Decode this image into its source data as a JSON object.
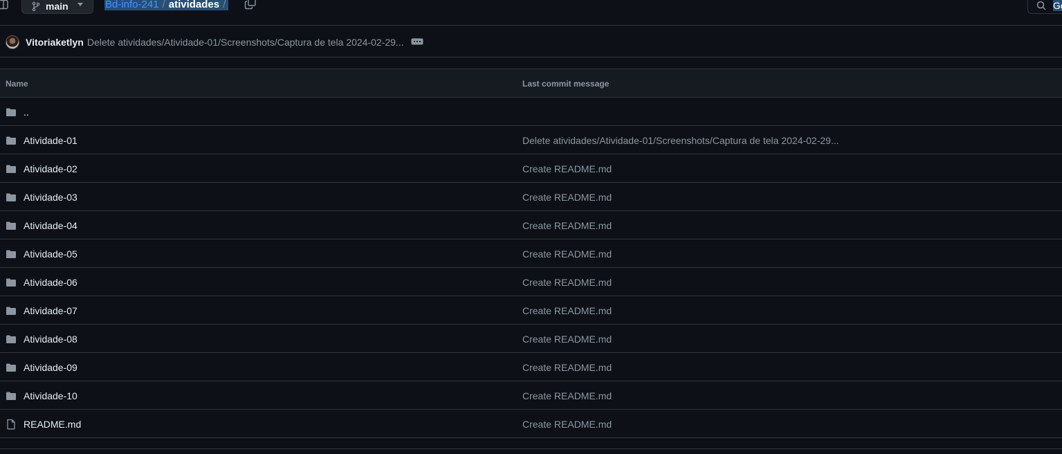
{
  "topbar": {
    "branch": "main",
    "breadcrumb": {
      "repo": "Bd-info-241",
      "separator": "/",
      "folder": "atividades",
      "trailing_separator": "/"
    },
    "goto_label": "Go"
  },
  "latest_commit": {
    "author": "Vitoriaketlyn",
    "message": "Delete atividades/Atividade-01/Screenshots/Captura de tela 2024-02-29..."
  },
  "table": {
    "headers": {
      "name": "Name",
      "message": "Last commit message"
    },
    "parent_dir": "..",
    "rows": [
      {
        "name": "Atividade-01",
        "message": "Delete atividades/Atividade-01/Screenshots/Captura de tela 2024-02-29...",
        "icon": "folder-icon"
      },
      {
        "name": "Atividade-02",
        "message": "Create README.md",
        "icon": "folder-icon"
      },
      {
        "name": "Atividade-03",
        "message": "Create README.md",
        "icon": "folder-icon"
      },
      {
        "name": "Atividade-04",
        "message": "Create README.md",
        "icon": "folder-icon"
      },
      {
        "name": "Atividade-05",
        "message": "Create README.md",
        "icon": "folder-icon"
      },
      {
        "name": "Atividade-06",
        "message": "Create README.md",
        "icon": "folder-icon"
      },
      {
        "name": "Atividade-07",
        "message": "Create README.md",
        "icon": "folder-icon"
      },
      {
        "name": "Atividade-08",
        "message": "Create README.md",
        "icon": "folder-icon"
      },
      {
        "name": "Atividade-09",
        "message": "Create README.md",
        "icon": "folder-icon"
      },
      {
        "name": "Atividade-10",
        "message": "Create README.md",
        "icon": "folder-icon"
      },
      {
        "name": "README.md",
        "message": "Create README.md",
        "icon": "file-icon"
      }
    ]
  },
  "colors": {
    "background": "#0d1117",
    "header_background": "#161b22",
    "border": "#30363d",
    "text": "#e6edf3",
    "muted": "#8d96a0",
    "link": "#4493f8",
    "selection": "#264f78"
  }
}
